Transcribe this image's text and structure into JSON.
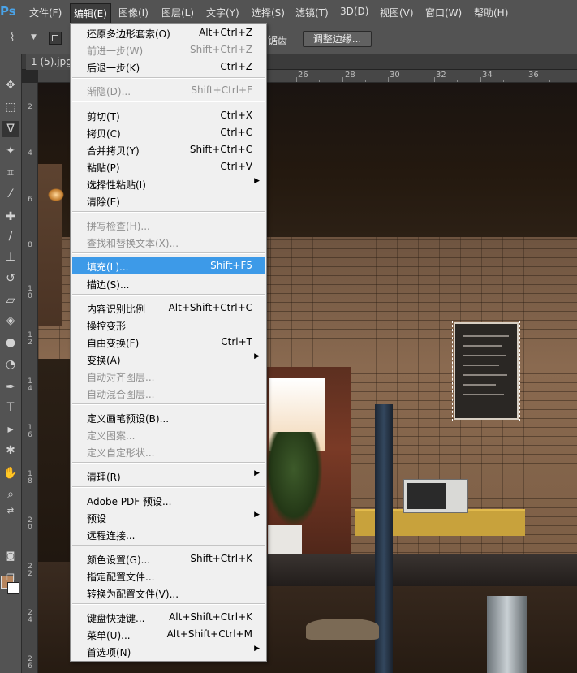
{
  "app": {
    "logo": "Ps"
  },
  "menubar": {
    "items": [
      {
        "label": "文件(F)"
      },
      {
        "label": "编辑(E)"
      },
      {
        "label": "图像(I)"
      },
      {
        "label": "图层(L)"
      },
      {
        "label": "文字(Y)"
      },
      {
        "label": "选择(S)"
      },
      {
        "label": "滤镜(T)"
      },
      {
        "label": "3D(D)"
      },
      {
        "label": "视图(V)"
      },
      {
        "label": "窗口(W)"
      },
      {
        "label": "帮助(H)"
      }
    ]
  },
  "options_bar": {
    "partial_text": "锯齿",
    "refine_edge_label": "调整边缘..."
  },
  "document_tab": {
    "label": "1 (5).jpg"
  },
  "ruler": {
    "top_numbers": [
      "26",
      "28",
      "30",
      "32",
      "34",
      "36"
    ],
    "left_numbers": [
      "2",
      "4",
      "6",
      "8",
      "10",
      "12",
      "14",
      "16",
      "18",
      "20",
      "22",
      "24",
      "26"
    ]
  },
  "colors": {
    "foreground": "#b7855d",
    "background": "#ffffff",
    "menu_highlight": "#3d9ae8"
  },
  "tools": [
    "move-tool-icon",
    "marquee-tool-icon",
    "polygonal-lasso-tool-icon",
    "magic-wand-tool-icon",
    "crop-tool-icon",
    "eyedropper-tool-icon",
    "spot-healing-tool-icon",
    "brush-tool-icon",
    "clone-stamp-tool-icon",
    "history-brush-tool-icon",
    "eraser-tool-icon",
    "paint-bucket-tool-icon",
    "blur-tool-icon",
    "dodge-tool-icon",
    "pen-tool-icon",
    "type-tool-icon",
    "path-selection-tool-icon",
    "custom-shape-tool-icon",
    "hand-tool-icon",
    "zoom-tool-icon"
  ],
  "edit_menu": {
    "items": [
      {
        "label": "还原多边形套索(O)",
        "shortcut": "Alt+Ctrl+Z",
        "enabled": true
      },
      {
        "label": "前进一步(W)",
        "shortcut": "Shift+Ctrl+Z",
        "enabled": false
      },
      {
        "label": "后退一步(K)",
        "shortcut": "Ctrl+Z",
        "enabled": true
      },
      {
        "label": "渐隐(D)...",
        "shortcut": "Shift+Ctrl+F",
        "enabled": false
      },
      {
        "label": "剪切(T)",
        "shortcut": "Ctrl+X",
        "enabled": true
      },
      {
        "label": "拷贝(C)",
        "shortcut": "Ctrl+C",
        "enabled": true
      },
      {
        "label": "合并拷贝(Y)",
        "shortcut": "Shift+Ctrl+C",
        "enabled": true
      },
      {
        "label": "粘贴(P)",
        "shortcut": "Ctrl+V",
        "enabled": true
      },
      {
        "label": "选择性粘贴(I)",
        "shortcut": "",
        "enabled": true,
        "submenu": true
      },
      {
        "label": "清除(E)",
        "shortcut": "",
        "enabled": true
      },
      {
        "label": "拼写检查(H)...",
        "shortcut": "",
        "enabled": false
      },
      {
        "label": "查找和替换文本(X)...",
        "shortcut": "",
        "enabled": false
      },
      {
        "label": "填充(L)...",
        "shortcut": "Shift+F5",
        "enabled": true,
        "highlighted": true
      },
      {
        "label": "描边(S)...",
        "shortcut": "",
        "enabled": true
      },
      {
        "label": "内容识别比例",
        "shortcut": "Alt+Shift+Ctrl+C",
        "enabled": true
      },
      {
        "label": "操控变形",
        "shortcut": "",
        "enabled": true
      },
      {
        "label": "自由变换(F)",
        "shortcut": "Ctrl+T",
        "enabled": true
      },
      {
        "label": "变换(A)",
        "shortcut": "",
        "enabled": true,
        "submenu": true
      },
      {
        "label": "自动对齐图层...",
        "shortcut": "",
        "enabled": false
      },
      {
        "label": "自动混合图层...",
        "shortcut": "",
        "enabled": false
      },
      {
        "label": "定义画笔预设(B)...",
        "shortcut": "",
        "enabled": true
      },
      {
        "label": "定义图案...",
        "shortcut": "",
        "enabled": false
      },
      {
        "label": "定义自定形状...",
        "shortcut": "",
        "enabled": false
      },
      {
        "label": "清理(R)",
        "shortcut": "",
        "enabled": true,
        "submenu": true
      },
      {
        "label": "Adobe PDF 预设...",
        "shortcut": "",
        "enabled": true
      },
      {
        "label": "预设",
        "shortcut": "",
        "enabled": true,
        "submenu": true
      },
      {
        "label": "远程连接...",
        "shortcut": "",
        "enabled": true
      },
      {
        "label": "颜色设置(G)...",
        "shortcut": "Shift+Ctrl+K",
        "enabled": true
      },
      {
        "label": "指定配置文件...",
        "shortcut": "",
        "enabled": true
      },
      {
        "label": "转换为配置文件(V)...",
        "shortcut": "",
        "enabled": true
      },
      {
        "label": "键盘快捷键...",
        "shortcut": "Alt+Shift+Ctrl+K",
        "enabled": true
      },
      {
        "label": "菜单(U)...",
        "shortcut": "Alt+Shift+Ctrl+M",
        "enabled": true
      },
      {
        "label": "首选项(N)",
        "shortcut": "",
        "enabled": true,
        "submenu": true
      }
    ]
  }
}
